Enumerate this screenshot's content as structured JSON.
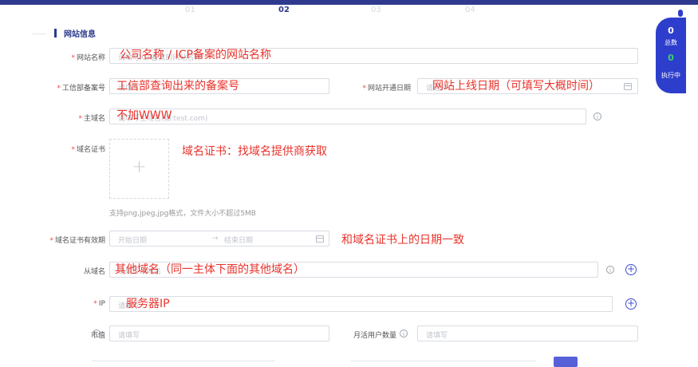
{
  "steps": [
    "01",
    "02",
    "03",
    "04"
  ],
  "section": {
    "title": "网站信息"
  },
  "fields": {
    "site_name": {
      "required": "*",
      "label": "网站名称",
      "placeholder": "请填写ICP备案的网站名称",
      "annotation": "公司名称 / ICP备案的网站名称"
    },
    "miit_record": {
      "required": "*",
      "label": "工信部备案号",
      "placeholder": "请填写",
      "annotation": "工信部查询出来的备案号"
    },
    "launch_date": {
      "required": "*",
      "label": "网站开通日期",
      "placeholder": "请选择",
      "annotation": "网站上线日期（可填写大概时间）"
    },
    "main_domain": {
      "required": "*",
      "label": "主域名",
      "placeholder": "请填写主域名(如:test.com)",
      "annotation": "不加WWW",
      "info_icon": "i"
    },
    "domain_cert": {
      "required": "*",
      "label": "域名证书",
      "upload_icon": "+",
      "hint": "支持png,jpeg,jpg格式，文件大小不超过5MB",
      "annotation": "域名证书：找域名提供商获取"
    },
    "cert_validity": {
      "required": "*",
      "label": "域名证书有效期",
      "start_placeholder": "开始日期",
      "arrow": "→",
      "end_placeholder": "结束日期",
      "annotation": "和域名证书上的日期一致"
    },
    "sub_domain": {
      "label": "从域名",
      "placeholder": "请填写从域名",
      "annotation": "其他域名（同一主体下面的其他域名）",
      "info_icon": "i",
      "add_icon": "+"
    },
    "ip": {
      "required": "*",
      "label": "IP",
      "placeholder": "请填写",
      "annotation": "服务器IP",
      "add_icon": "+"
    },
    "market_value": {
      "label": "市值",
      "info_icon": "i",
      "placeholder": "请填写"
    },
    "mau": {
      "label": "月活用户数量",
      "info_icon": "i",
      "placeholder": "请填写"
    }
  },
  "sidebar": {
    "total_count": "0",
    "total_label": "总数",
    "running_count": "0",
    "running_label": "执行中"
  },
  "colors": {
    "accent": "#2b3a8c",
    "primary": "#2d3ecc",
    "annotation": "#e8332c",
    "required": "#f04848"
  }
}
